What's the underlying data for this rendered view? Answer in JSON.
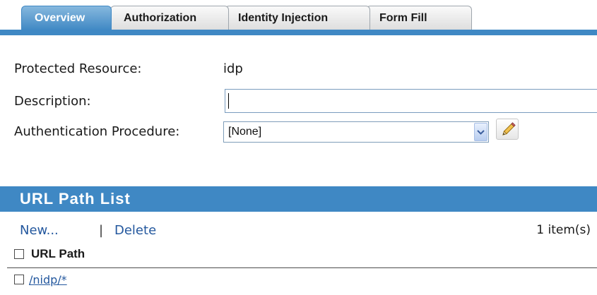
{
  "tabs": [
    {
      "label": "Overview",
      "active": true
    },
    {
      "label": "Authorization",
      "active": false
    },
    {
      "label": "Identity Injection",
      "active": false
    },
    {
      "label": "Form Fill",
      "active": false
    }
  ],
  "form": {
    "protected_resource_label": "Protected Resource:",
    "protected_resource_value": "idp",
    "description_label": "Description:",
    "description_value": "",
    "auth_procedure_label": "Authentication Procedure:",
    "auth_procedure_value": "[None]"
  },
  "url_path_list": {
    "title": "URL Path List",
    "new_label": "New...",
    "separator": "|",
    "delete_label": "Delete",
    "item_count": "1 item(s)",
    "column_header": "URL Path",
    "rows": [
      {
        "path": "/nidp/*"
      }
    ]
  },
  "colors": {
    "accent": "#3f88c4",
    "link": "#24589e"
  },
  "icons": {
    "select_arrow": "chevron-down-icon",
    "edit": "pencil-icon"
  }
}
